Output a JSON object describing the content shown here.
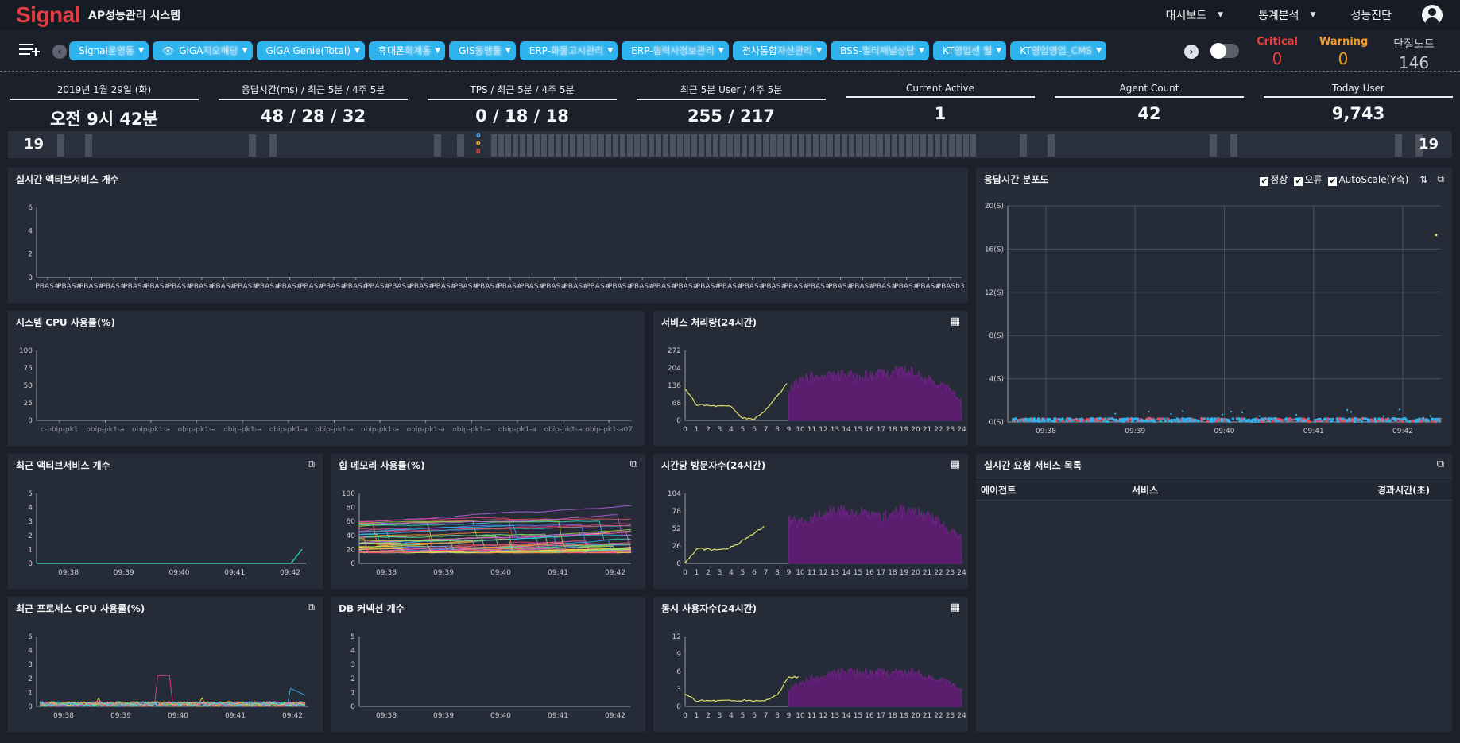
{
  "app": {
    "logo": "Signal",
    "title": "AP성능관리 시스템"
  },
  "nav": [
    {
      "label": "대시보드",
      "has_dropdown": true
    },
    {
      "label": "통계분석",
      "has_dropdown": true
    },
    {
      "label": "성능진단",
      "has_dropdown": false
    }
  ],
  "agents": [
    {
      "label": "Signal",
      "blur": "운영통",
      "icon": ""
    },
    {
      "label": "GiGA",
      "blur": "지오해당",
      "icon": "eye"
    },
    {
      "label": "GiGA Genie(Total)",
      "blur": "",
      "icon": ""
    },
    {
      "label": "휴대폰",
      "blur": "회계통",
      "icon": ""
    },
    {
      "label": "GIS",
      "blur": "동맹툴",
      "icon": ""
    },
    {
      "label": "ERP-",
      "blur": "화물고시관리",
      "icon": ""
    },
    {
      "label": "ERP-",
      "blur": "협력사정보관리",
      "icon": ""
    },
    {
      "label": "전사통합",
      "blur": "자산관리",
      "icon": ""
    },
    {
      "label": "BSS-",
      "blur": "멀티채널상담",
      "icon": ""
    },
    {
      "label": "KT",
      "blur": "영업센 웹",
      "icon": ""
    },
    {
      "label": "KT",
      "blur": "영업영업_CMS",
      "icon": ""
    }
  ],
  "status": {
    "critical": {
      "label": "Critical",
      "value": "0",
      "color": "#e8413d"
    },
    "warning": {
      "label": "Warning",
      "value": "0",
      "color": "#f29b27"
    },
    "down": {
      "label": "단절노드",
      "value": "146",
      "color": "#c9ccd2"
    }
  },
  "kpis": [
    {
      "label": "2019년 1월 29일 (화)",
      "value": "오전 9시 42분"
    },
    {
      "label": "응답시간(ms) / 최근 5분 / 4주 5분",
      "value": "48 / 28 / 32"
    },
    {
      "label": "TPS / 최근 5분 / 4주 5분",
      "value": "0 / 18 / 18"
    },
    {
      "label": "최근 5분 User / 4주 5분",
      "value": "255 / 217"
    },
    {
      "label": "Current Active",
      "value": "1"
    },
    {
      "label": "Agent Count",
      "value": "42"
    },
    {
      "label": "Today User",
      "value": "9,743"
    }
  ],
  "timeline": {
    "left": "19",
    "right": "19",
    "stack": [
      "0",
      "0",
      "0"
    ],
    "stack_colors": [
      "#3aa9ff",
      "#f2b134",
      "#e8413d"
    ]
  },
  "panels": {
    "active_service": {
      "title": "실시간 액티브서비스 개수"
    },
    "system_cpu": {
      "title": "시스템 CPU 사용률(%)"
    },
    "throughput": {
      "title": "서비스 처리량(24시간)"
    },
    "response_dist": {
      "title": "응답시간 분포도",
      "normal": "정상",
      "error": "오류",
      "autoscale": "AutoScale(Y축)"
    },
    "recent_active": {
      "title": "최근 액티브서비스 개수"
    },
    "heap": {
      "title": "힙 메모리 사용률(%)"
    },
    "visitors": {
      "title": "시간당 방문자수(24시간)"
    },
    "request_list": {
      "title": "실시간 요청 서비스 목록",
      "columns": [
        "에이전트",
        "서비스",
        "경과시간(초)"
      ]
    },
    "process_cpu": {
      "title": "최근 프로세스 CPU 사용률(%)"
    },
    "db_conn": {
      "title": "DB 커넥션 개수"
    },
    "concurrent": {
      "title": "동시 사용자수(24시간)"
    }
  },
  "chart_data": [
    {
      "id": "active_service",
      "type": "bar",
      "yticks": [
        "0",
        "2",
        "4",
        "6"
      ],
      "categories": [
        "PBAS#",
        "PBAS#",
        "PBAS#",
        "PBAS#",
        "PBAS#",
        "PBAS#",
        "PBAS#",
        "PBAS#",
        "PBAS#",
        "PBAS#",
        "PBAS#",
        "PBAS#",
        "PBAS#",
        "PBAS#",
        "PBAS#",
        "PBAS#",
        "PBAS#",
        "PBAS#",
        "PBAS#",
        "PBAS#",
        "PBAS#",
        "PBAS#",
        "PBAS#",
        "PBAS#",
        "PBAS#",
        "PBAS#",
        "PBAS#",
        "PBAS#",
        "PBAS#",
        "PBAS#",
        "PBAS#",
        "PBAS#",
        "PBAS#",
        "PBAS#",
        "PBAS#",
        "PBAS#",
        "PBAS#",
        "PBAS#",
        "PBAS#",
        "PBAS#",
        "PBAS#",
        "PBASb3"
      ],
      "values": [
        0,
        0,
        0,
        0,
        0,
        0,
        0,
        0,
        0,
        0,
        0,
        0,
        0,
        0,
        0,
        0,
        0,
        0,
        0,
        0,
        0,
        0,
        0,
        0,
        0,
        0,
        0,
        0,
        0,
        0,
        0,
        0,
        0,
        0,
        0,
        0,
        0,
        0,
        0,
        0,
        0,
        0
      ],
      "ylim": [
        0,
        6
      ]
    },
    {
      "id": "system_cpu",
      "type": "bar",
      "yticks": [
        "0",
        "25",
        "50",
        "75",
        "100"
      ],
      "categories": [
        "c-obip-pk1",
        "obip-pk1-a",
        "obip-pk1-a",
        "obip-pk1-a",
        "obip-pk1-a",
        "obip-pk1-a",
        "obip-pk1-a",
        "obip-pk1-a",
        "obip-pk1-a",
        "obip-pk1-a",
        "obip-pk1-a",
        "obip-pk1-a",
        "obip-pk1-a07"
      ],
      "values": [
        0,
        0,
        0,
        0,
        0,
        0,
        0,
        0,
        0,
        0,
        0,
        0,
        0
      ],
      "ylim": [
        0,
        100
      ]
    },
    {
      "id": "throughput",
      "type": "area",
      "yticks": [
        "0",
        "68",
        "136",
        "204",
        "272"
      ],
      "x": [
        "0",
        "1",
        "2",
        "3",
        "4",
        "5",
        "6",
        "7",
        "8",
        "9",
        "10",
        "11",
        "12",
        "13",
        "14",
        "15",
        "16",
        "17",
        "18",
        "19",
        "20",
        "21",
        "22",
        "23",
        "24"
      ],
      "today": [
        120,
        62,
        58,
        56,
        54,
        8,
        6,
        40,
        96,
        150
      ],
      "previous": [
        0,
        0,
        0,
        0,
        0,
        0,
        0,
        0,
        0,
        120,
        160,
        175,
        172,
        180,
        178,
        170,
        182,
        185,
        192,
        205,
        180,
        165,
        150,
        120,
        80
      ],
      "ylim": [
        0,
        272
      ]
    },
    {
      "id": "response_dist",
      "type": "scatter",
      "yticks": [
        "0(S)",
        "4(S)",
        "8(S)",
        "12(S)",
        "16(S)",
        "20(S)"
      ],
      "x": [
        "09:38",
        "09:39",
        "09:40",
        "09:41",
        "09:42"
      ],
      "ylim": [
        0,
        20
      ],
      "points": {
        "outlier": {
          "x": "09:42",
          "y": 17.3
        }
      }
    },
    {
      "id": "recent_active",
      "type": "line",
      "yticks": [
        "0",
        "1",
        "2",
        "3",
        "4",
        "5"
      ],
      "x": [
        "09:38",
        "09:39",
        "09:40",
        "09:41",
        "09:42"
      ],
      "values": [
        0,
        0,
        0,
        0,
        0,
        0,
        0,
        0,
        0,
        0,
        0,
        0,
        0,
        0,
        0,
        0,
        0,
        0,
        0,
        0,
        0,
        0,
        0,
        0,
        1
      ],
      "ylim": [
        0,
        5
      ]
    },
    {
      "id": "heap",
      "type": "line",
      "yticks": [
        "0",
        "20",
        "40",
        "60",
        "80",
        "100"
      ],
      "x": [
        "09:38",
        "09:39",
        "09:40",
        "09:41",
        "09:42"
      ],
      "series_count": 42,
      "range": [
        15,
        90
      ],
      "ylim": [
        0,
        100
      ]
    },
    {
      "id": "visitors",
      "type": "area",
      "yticks": [
        "0",
        "26",
        "52",
        "78",
        "104"
      ],
      "x": [
        "0",
        "1",
        "2",
        "3",
        "4",
        "5",
        "6",
        "7",
        "8",
        "9",
        "10",
        "11",
        "12",
        "13",
        "14",
        "15",
        "16",
        "17",
        "18",
        "19",
        "20",
        "21",
        "22",
        "23",
        "24"
      ],
      "today": [
        0,
        22,
        21,
        20,
        24,
        34,
        46,
        57
      ],
      "previous": [
        0,
        0,
        0,
        0,
        0,
        0,
        0,
        0,
        60,
        66,
        64,
        70,
        76,
        80,
        79,
        77,
        74,
        70,
        77,
        80,
        78,
        73,
        64,
        52,
        40
      ],
      "ylim": [
        0,
        104
      ]
    },
    {
      "id": "process_cpu",
      "type": "line",
      "yticks": [
        "0",
        "1",
        "2",
        "3",
        "4",
        "5"
      ],
      "x": [
        "09:38",
        "09:39",
        "09:40",
        "09:41",
        "09:42"
      ],
      "ylim": [
        0,
        5
      ]
    },
    {
      "id": "db_conn",
      "type": "line",
      "yticks": [
        "0",
        "1",
        "2",
        "3",
        "4",
        "5"
      ],
      "x": [
        "09:38",
        "09:39",
        "09:40",
        "09:41",
        "09:42"
      ],
      "values": [],
      "ylim": [
        0,
        5
      ]
    },
    {
      "id": "concurrent",
      "type": "area",
      "yticks": [
        "0",
        "3",
        "6",
        "9",
        "12"
      ],
      "x": [
        "0",
        "1",
        "2",
        "3",
        "4",
        "5",
        "6",
        "7",
        "8",
        "9",
        "10",
        "11",
        "12",
        "13",
        "14",
        "15",
        "16",
        "17",
        "18",
        "19",
        "20",
        "21",
        "22",
        "23",
        "24"
      ],
      "today": [
        2,
        1,
        1,
        1,
        1,
        1,
        1,
        1,
        2,
        5,
        5
      ],
      "previous": [
        0,
        0,
        0,
        0,
        0,
        0,
        0,
        0,
        0,
        3,
        4,
        5,
        5,
        6,
        6,
        6,
        6,
        6,
        6,
        6,
        6,
        5,
        5,
        4,
        3
      ],
      "ylim": [
        0,
        12
      ]
    }
  ]
}
